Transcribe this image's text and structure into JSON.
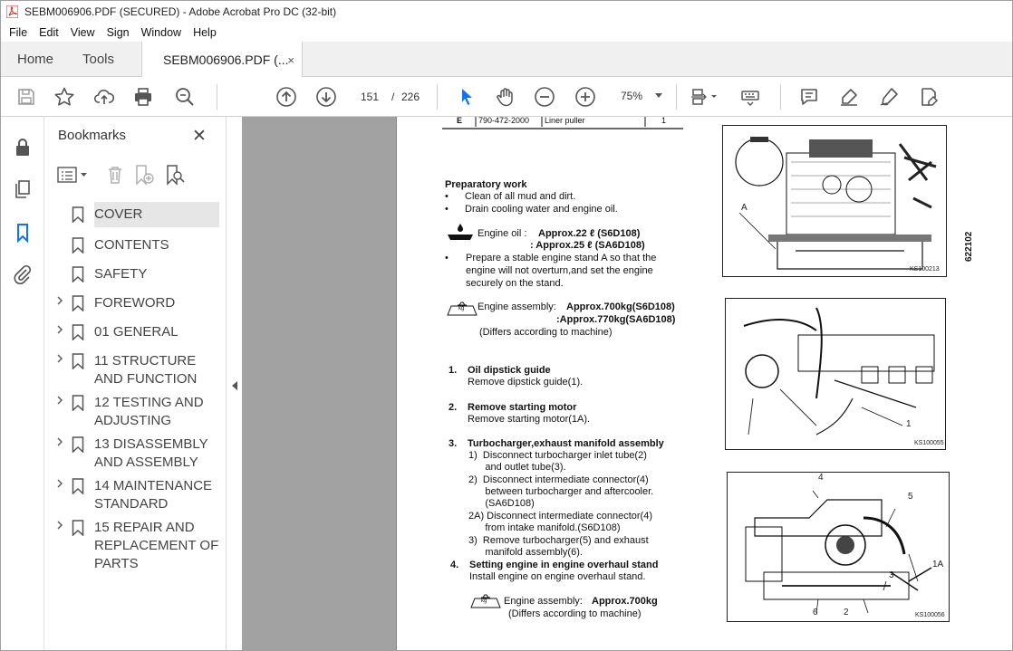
{
  "window": {
    "title": "SEBM006906.PDF (SECURED) - Adobe Acrobat Pro DC (32-bit)"
  },
  "menu": [
    "File",
    "Edit",
    "View",
    "Sign",
    "Window",
    "Help"
  ],
  "tabs": {
    "home": "Home",
    "tools": "Tools",
    "doc": "SEBM006906.PDF (...",
    "close": "×"
  },
  "toolbar": {
    "page_current": "151",
    "page_sep": "/",
    "page_total": "226",
    "zoom": "75%"
  },
  "colors": {
    "accent": "#1473e6",
    "pdf_red": "#e0241b"
  },
  "bookmarks": {
    "title": "Bookmarks",
    "close": "✕",
    "items": [
      {
        "label": "COVER",
        "expandable": false,
        "selected": true
      },
      {
        "label": "CONTENTS",
        "expandable": false
      },
      {
        "label": "SAFETY",
        "expandable": false
      },
      {
        "label": "FOREWORD",
        "expandable": true
      },
      {
        "label": "01 GENERAL",
        "expandable": true
      },
      {
        "label": "11 STRUCTURE AND FUNCTION",
        "expandable": true
      },
      {
        "label": "12 TESTING AND ADJUSTING",
        "expandable": true
      },
      {
        "label": "13 DISASSEMBLY AND ASSEMBLY",
        "expandable": true
      },
      {
        "label": "14 MAINTENANCE STANDARD",
        "expandable": true
      },
      {
        "label": "15 REPAIR AND REPLACEMENT OF PARTS",
        "expandable": true
      }
    ]
  },
  "pdf": {
    "table_row": {
      "col1": "E",
      "col2": "790-472-2000",
      "col3": "Liner puller",
      "col4": "1"
    },
    "prep_title": "Preparatory work",
    "prep_items": [
      "Clean of all mud and dirt.",
      "Drain cooling water and engine oil."
    ],
    "oil_label": "Engine oil : ",
    "oil_1": "Approx.22 ℓ (S6D108)",
    "oil_2": ": Approx.25 ℓ (SA6D108)",
    "prep_stand_1": "Prepare a stable engine stand A so that the",
    "prep_stand_2": "engine will not overturn,and set the engine",
    "prep_stand_3": "securely on the stand.",
    "asm_label": "Engine assembly:",
    "asm_1": "Approx.700kg(S6D108)",
    "asm_2": ":Approx.770kg(SA6D108)",
    "asm_note": "(Differs according to machine)",
    "kg": "kg",
    "step1_title": "Oil dipstick guide",
    "step1_text": "Remove dipstick guide(1).",
    "step2_title": "Remove starting motor",
    "step2_text": "Remove starting motor(1A).",
    "step3_title": "Turbocharger,exhaust manifold assembly",
    "step3_sub": [
      "1)  Disconnect turbocharger inlet tube(2)",
      "      and outlet tube(3).",
      "2)  Disconnect intermediate connector(4)",
      "      between turbocharger and aftercooler.",
      "      (SA6D108)",
      "2A) Disconnect intermediate connector(4)",
      "      from intake manifold.(S6D108)",
      "3)  Remove turbocharger(5) and exhaust",
      "      manifold assembly(6)."
    ],
    "step4_title": "Setting engine in engine overhaul stand",
    "step4_text": "Install engine on engine overhaul stand.",
    "asm2_label": "Engine assembly:",
    "asm2_val": "Approx.700kg",
    "asm2_note": "(Differs according to machine)",
    "n1": "1.",
    "n2": "2.",
    "n3": "3.",
    "n4": "4.",
    "fig1_cap": "KS100213",
    "fig2_cap": "KS100055",
    "fig3_cap": "KS100056",
    "fig1_label": "A",
    "fig2_label": "1",
    "fig3_labels": [
      "4",
      "5",
      "3",
      "1A",
      "6",
      "2"
    ],
    "side_code": "622102"
  }
}
